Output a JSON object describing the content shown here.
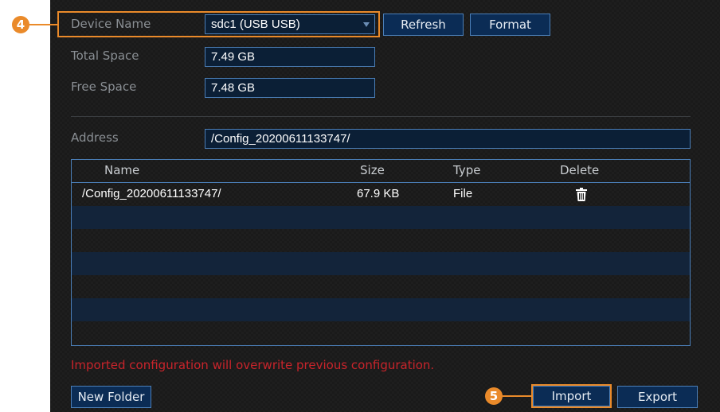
{
  "device": {
    "name_label": "Device Name",
    "name_value": "sdc1 (USB USB)",
    "refresh_label": "Refresh",
    "format_label": "Format",
    "total_space_label": "Total Space",
    "total_space_value": "7.49 GB",
    "free_space_label": "Free Space",
    "free_space_value": "7.48 GB"
  },
  "address": {
    "label": "Address",
    "value": "/Config_20200611133747/"
  },
  "table": {
    "headers": [
      "Name",
      "Size",
      "Type",
      "Delete"
    ],
    "rows": [
      {
        "name": "/Config_20200611133747/",
        "size": "67.9 KB",
        "type": "File",
        "delete_icon": "trash-icon"
      }
    ]
  },
  "warning": "Imported configuration will overwrite previous configuration.",
  "buttons": {
    "new_folder": "New Folder",
    "import": "Import",
    "export": "Export"
  },
  "callouts": {
    "step_4": "4",
    "step_5": "5"
  },
  "colors": {
    "accent": "#ea8a2a",
    "warning": "#c8242b",
    "field_border": "#4b7fb8",
    "button_bg": "#0b2c55"
  }
}
